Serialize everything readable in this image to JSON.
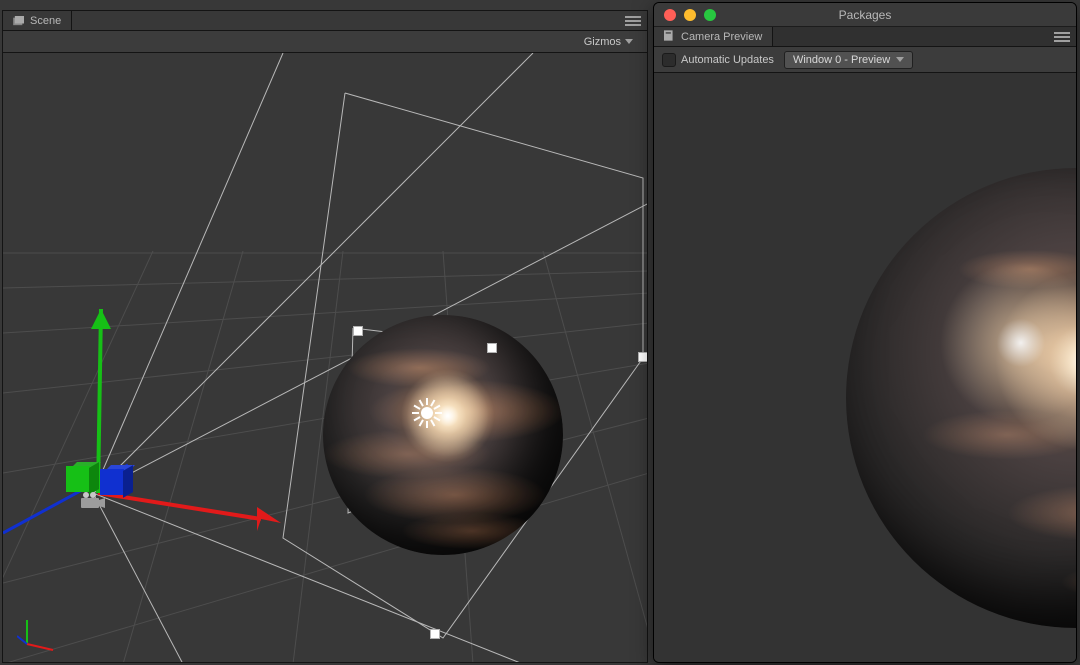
{
  "scene_panel": {
    "tab_label": "Scene",
    "gizmos_label": "Gizmos"
  },
  "packages_window": {
    "title": "Packages",
    "tab_label": "Camera Preview",
    "auto_updates_label": "Automatic Updates",
    "auto_updates_checked": false,
    "window_dropdown": "Window 0 - Preview"
  },
  "colors": {
    "axis_x": "#e21a1a",
    "axis_y": "#16c016",
    "axis_z": "#1030d0"
  }
}
